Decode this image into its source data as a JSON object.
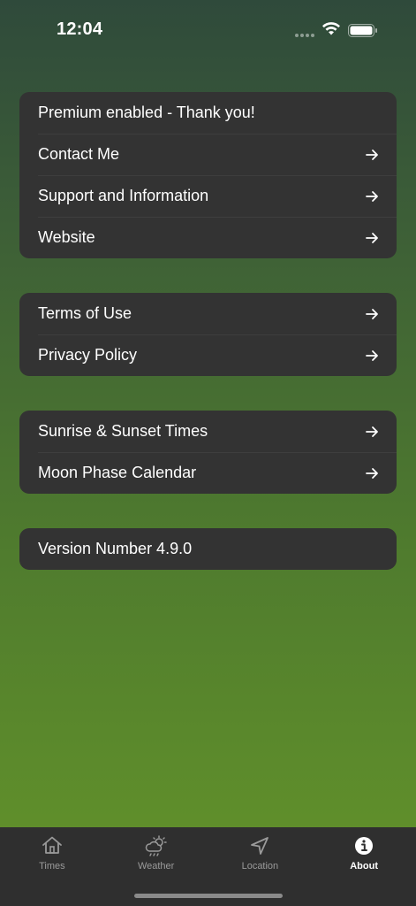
{
  "status": {
    "time": "12:04"
  },
  "sections": [
    {
      "rows": [
        {
          "label": "Premium enabled - Thank you!",
          "arrow": false
        },
        {
          "label": "Contact Me",
          "arrow": true
        },
        {
          "label": "Support and Information",
          "arrow": true
        },
        {
          "label": "Website",
          "arrow": true
        }
      ]
    },
    {
      "rows": [
        {
          "label": "Terms of Use",
          "arrow": true
        },
        {
          "label": "Privacy Policy",
          "arrow": true
        }
      ]
    },
    {
      "rows": [
        {
          "label": "Sunrise & Sunset Times",
          "arrow": true
        },
        {
          "label": "Moon Phase Calendar",
          "arrow": true
        }
      ]
    },
    {
      "rows": [
        {
          "label": "Version Number 4.9.0",
          "arrow": false
        }
      ]
    }
  ],
  "tabs": [
    {
      "label": "Times",
      "icon": "house-icon",
      "active": false
    },
    {
      "label": "Weather",
      "icon": "sun-cloud-icon",
      "active": false
    },
    {
      "label": "Location",
      "icon": "location-arrow-icon",
      "active": false
    },
    {
      "label": "About",
      "icon": "info-icon",
      "active": true
    }
  ],
  "colors": {
    "card": "#333333",
    "tab_bar": "#2f2f2f",
    "gradient_top": "#2f4a3b",
    "gradient_bottom": "#64942a"
  }
}
